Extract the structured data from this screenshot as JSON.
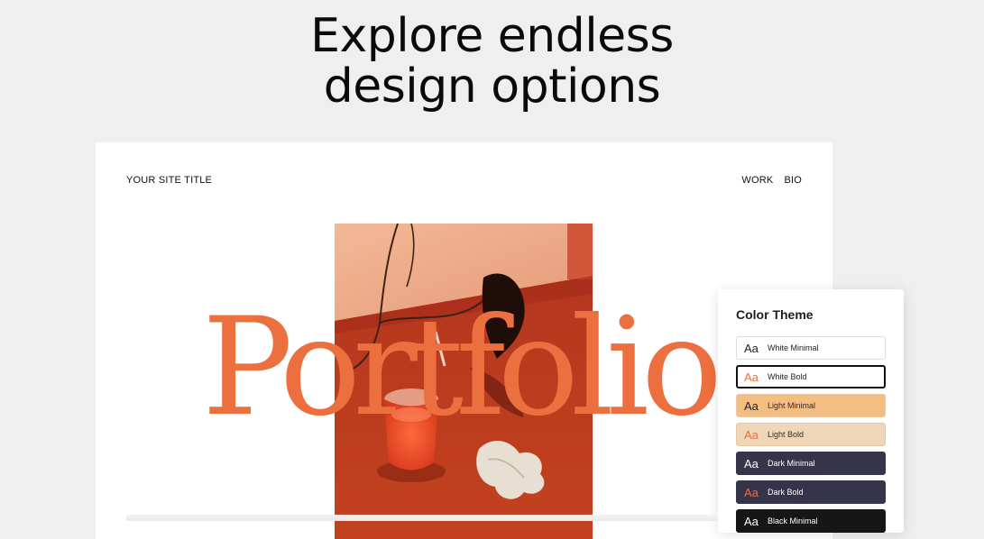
{
  "headline": {
    "line1": "Explore endless",
    "line2": "design options"
  },
  "site": {
    "title": "YOUR SITE TITLE",
    "nav": [
      "WORK",
      "BIO"
    ],
    "hero_word": "Portfolio",
    "accent_color": "#ec6f3f"
  },
  "color_theme_panel": {
    "title": "Color Theme",
    "sample_glyph": "Aa",
    "themes": [
      {
        "name": "White Minimal",
        "bg": "#ffffff",
        "border": "#dddddd",
        "glyph_color": "#222222",
        "text_color": "#222222",
        "selected": false
      },
      {
        "name": "White Bold",
        "bg": "#ffffff",
        "border": "#111111",
        "glyph_color": "#ec6f3f",
        "text_color": "#222222",
        "selected": true
      },
      {
        "name": "Light Minimal",
        "bg": "#f4bd82",
        "border": "#e9c9a3",
        "glyph_color": "#222222",
        "text_color": "#3a2a1a",
        "selected": false
      },
      {
        "name": "Light Bold",
        "bg": "#f0d6b8",
        "border": "#e6c7a2",
        "glyph_color": "#ec6f3f",
        "text_color": "#3a2a1a",
        "selected": false
      },
      {
        "name": "Dark Minimal",
        "bg": "#35344a",
        "border": "#35344a",
        "glyph_color": "#ffffff",
        "text_color": "#ffffff",
        "selected": false
      },
      {
        "name": "Dark Bold",
        "bg": "#35344a",
        "border": "#35344a",
        "glyph_color": "#ec6f3f",
        "text_color": "#ffffff",
        "selected": false
      },
      {
        "name": "Black Minimal",
        "bg": "#161616",
        "border": "#161616",
        "glyph_color": "#ffffff",
        "text_color": "#ffffff",
        "selected": false
      }
    ]
  }
}
